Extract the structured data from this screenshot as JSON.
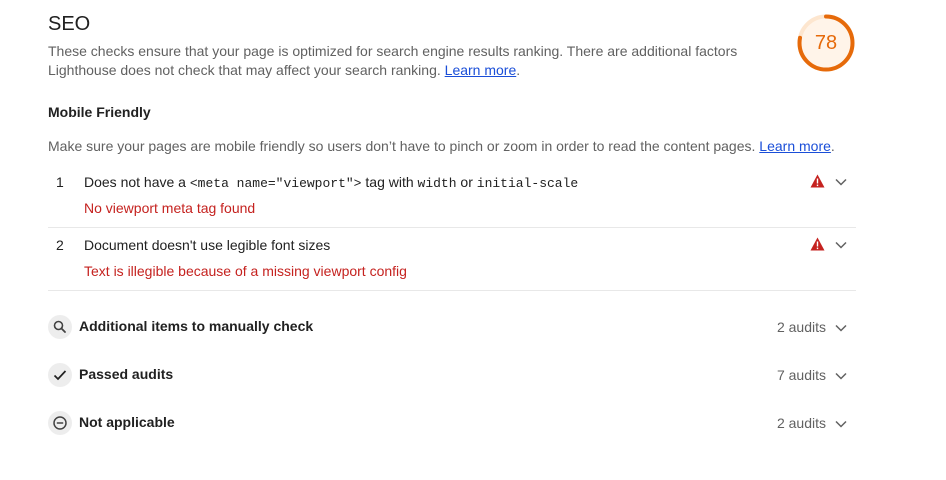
{
  "category": {
    "title": "SEO",
    "description": "These checks ensure that your page is optimized for search engine results ranking. There are additional factors Lighthouse does not check that may affect your search ranking.",
    "learn_more": "Learn more",
    "score": "78",
    "score_fraction": 0.78,
    "score_color": "#e66a0a"
  },
  "group": {
    "title": "Mobile Friendly",
    "description": "Make sure your pages are mobile friendly so users don’t have to pinch or zoom in order to read the content pages.",
    "learn_more": "Learn more",
    "period": "."
  },
  "audits": [
    {
      "number": "1",
      "title_parts": [
        "Does not have a ",
        "<meta name=\"viewport\">",
        " tag with ",
        "width",
        " or ",
        "initial-scale"
      ],
      "subtitle": "No viewport meta tag found",
      "status_icon": "warning-triangle-icon"
    },
    {
      "number": "2",
      "title": "Document doesn't use legible font sizes",
      "subtitle": "Text is illegible because of a missing viewport config",
      "status_icon": "warning-triangle-icon"
    }
  ],
  "clumps": [
    {
      "title": "Additional items to manually check",
      "count": "2 audits",
      "icon": "search-icon"
    },
    {
      "title": "Passed audits",
      "count": "7 audits",
      "icon": "checkmark-icon"
    },
    {
      "title": "Not applicable",
      "count": "2 audits",
      "icon": "minus-circle-icon"
    }
  ],
  "colors": {
    "fail": "#c5221f",
    "average": "#e66a0a",
    "link": "#1a4ed8"
  }
}
